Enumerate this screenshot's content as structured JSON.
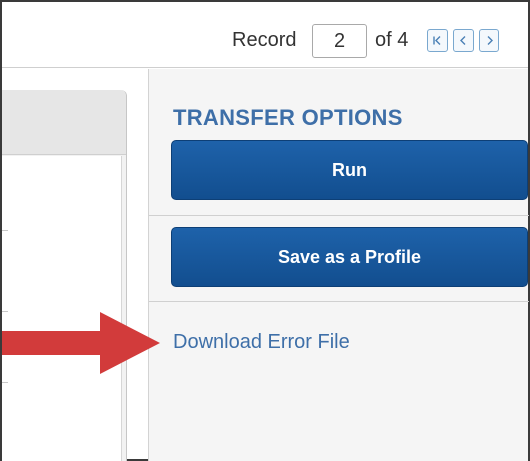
{
  "record_nav": {
    "label": "Record",
    "current": "2",
    "of_total": "of 4",
    "first_icon": "first-page-icon",
    "prev_icon": "chevron-left-icon",
    "next_icon": "chevron-right-icon"
  },
  "transfer_options": {
    "title": "TRANSFER OPTIONS",
    "run_label": "Run",
    "save_profile_label": "Save as a Profile",
    "download_error_label": "Download Error File"
  },
  "callout": {
    "icon": "red-arrow-icon",
    "color": "#d23b3b"
  },
  "colors": {
    "button_blue": "#1a5a9e",
    "title_blue": "#3e6fa8",
    "link_blue": "#3e6fa8",
    "nav_border": "#7aa8cf"
  }
}
